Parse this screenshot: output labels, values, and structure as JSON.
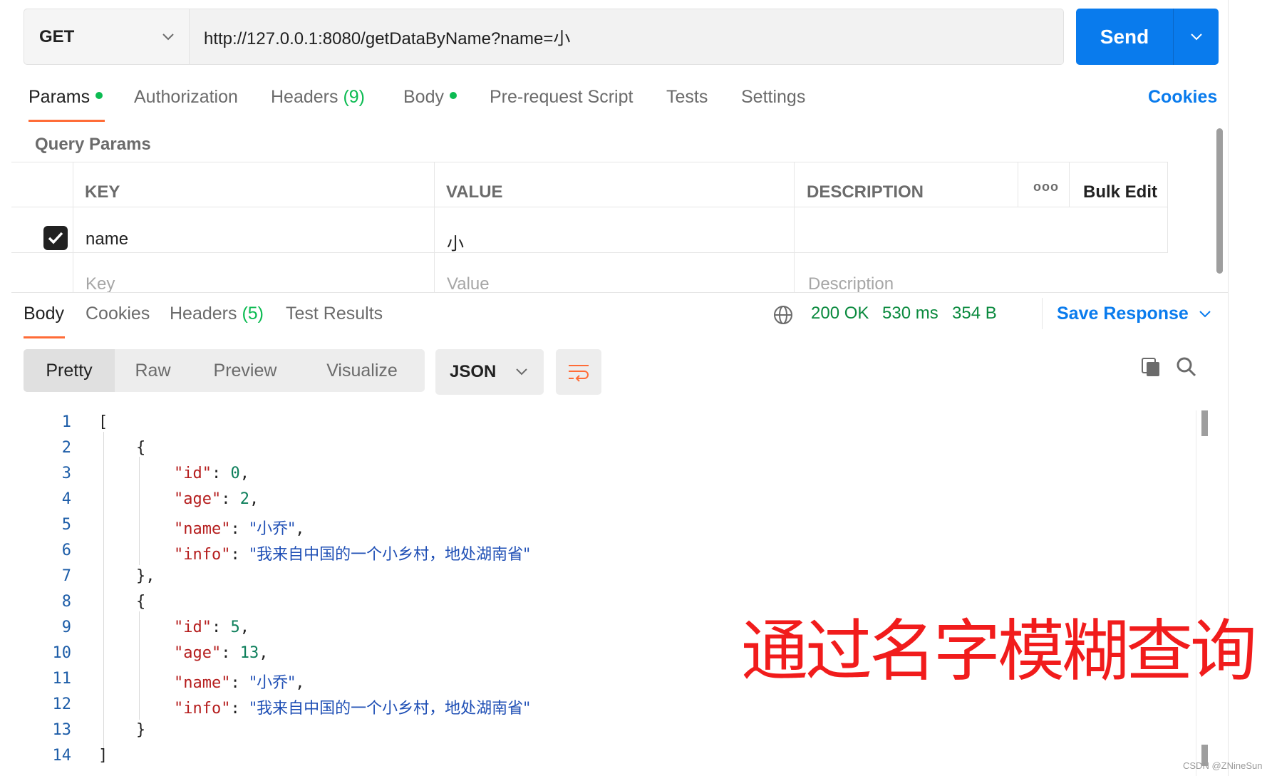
{
  "request": {
    "method": "GET",
    "url": "http://127.0.0.1:8080/getDataByName?name=小",
    "send_label": "Send"
  },
  "request_tabs": [
    {
      "label": "Params",
      "active": true,
      "dot": true
    },
    {
      "label": "Authorization"
    },
    {
      "label": "Headers",
      "count": "(9)"
    },
    {
      "label": "Body",
      "dot": true
    },
    {
      "label": "Pre-request Script"
    },
    {
      "label": "Tests"
    },
    {
      "label": "Settings"
    }
  ],
  "cookies_label": "Cookies",
  "query_params": {
    "title": "Query Params",
    "headers": {
      "key": "KEY",
      "value": "VALUE",
      "description": "DESCRIPTION",
      "more": "ooo",
      "bulk_edit": "Bulk Edit"
    },
    "rows": [
      {
        "checked": true,
        "key": "name",
        "value": "小",
        "description": ""
      }
    ],
    "placeholders": {
      "key": "Key",
      "value": "Value",
      "description": "Description"
    }
  },
  "response": {
    "tabs": [
      {
        "label": "Body",
        "active": true
      },
      {
        "label": "Cookies"
      },
      {
        "label": "Headers",
        "count": "(5)"
      },
      {
        "label": "Test Results"
      }
    ],
    "status": "200 OK",
    "time": "530 ms",
    "size": "354 B",
    "save_label": "Save Response",
    "views": [
      "Pretty",
      "Raw",
      "Preview",
      "Visualize"
    ],
    "active_view": "Pretty",
    "format": "JSON",
    "line_numbers": [
      "1",
      "2",
      "3",
      "4",
      "5",
      "6",
      "7",
      "8",
      "9",
      "10",
      "11",
      "12",
      "13",
      "14"
    ],
    "body": [
      {
        "id": 0,
        "age": 2,
        "name": "小乔",
        "info": "我来自中国的一个小乡村，地处湖南省"
      },
      {
        "id": 5,
        "age": 13,
        "name": "小乔",
        "info": "我来自中国的一个小乡村，地处湖南省"
      }
    ]
  },
  "annotation": "通过名字模糊查询",
  "watermark": "CSDN @ZNineSun",
  "colors": {
    "accent": "#ff6c37",
    "primary": "#097bed",
    "success": "#0cbb52"
  }
}
